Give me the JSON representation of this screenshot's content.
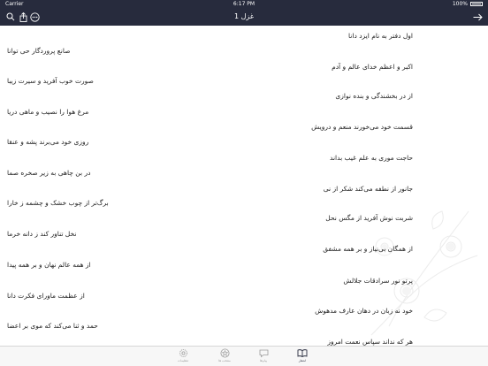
{
  "status_bar": {
    "carrier": "Carrier",
    "time": "6:17 PM",
    "battery": "100%"
  },
  "nav": {
    "title": "غزل 1"
  },
  "poem": {
    "right": [
      "اول دفتر به نام ایزد دانا",
      "اکبر و اعظم خدای عالم و آدم",
      "از در بخشندگی و بنده نوازی",
      "قسمت خود می‌خورند منعم و درویش",
      "حاجت موری به علم غیب بداند",
      "جانور از نطفه می‌کند شکر از نی",
      "شربت نوش آفرید از مگس نحل",
      "از همگان بی‌نیاز و بر همه مشفق",
      "پرتو نور سرادقات جلالش",
      "خود نه زبان در دهان عارف مدهوش",
      "هر که نداند سپاس نعمت امروز"
    ],
    "left": [
      "صانع پروردگار حی توانا",
      "صورت خوب آفرید و سیرت زیبا",
      "مرغ هوا را نصیب و ماهی دریا",
      "روزی خود می‌برند پشه و عنقا",
      "در بن چاهی به زیر صخره صما",
      "برگ‌تر از چوب خشک و چشمه ز خارا",
      "نخل تناور کند ز دانه خرما",
      "از همه عالم نهان و بر همه پیدا",
      "از عظمت ماورای فکرت دانا",
      "حمد و ثنا می‌کند که موی بر اعضا"
    ]
  },
  "tabs": [
    {
      "label": "تنظیمات",
      "icon": "gear-icon"
    },
    {
      "label": "منتخب ها",
      "icon": "star-icon"
    },
    {
      "label": "پیام‌ها",
      "icon": "chat-icon"
    },
    {
      "label": "اشعار",
      "icon": "book-icon"
    }
  ]
}
